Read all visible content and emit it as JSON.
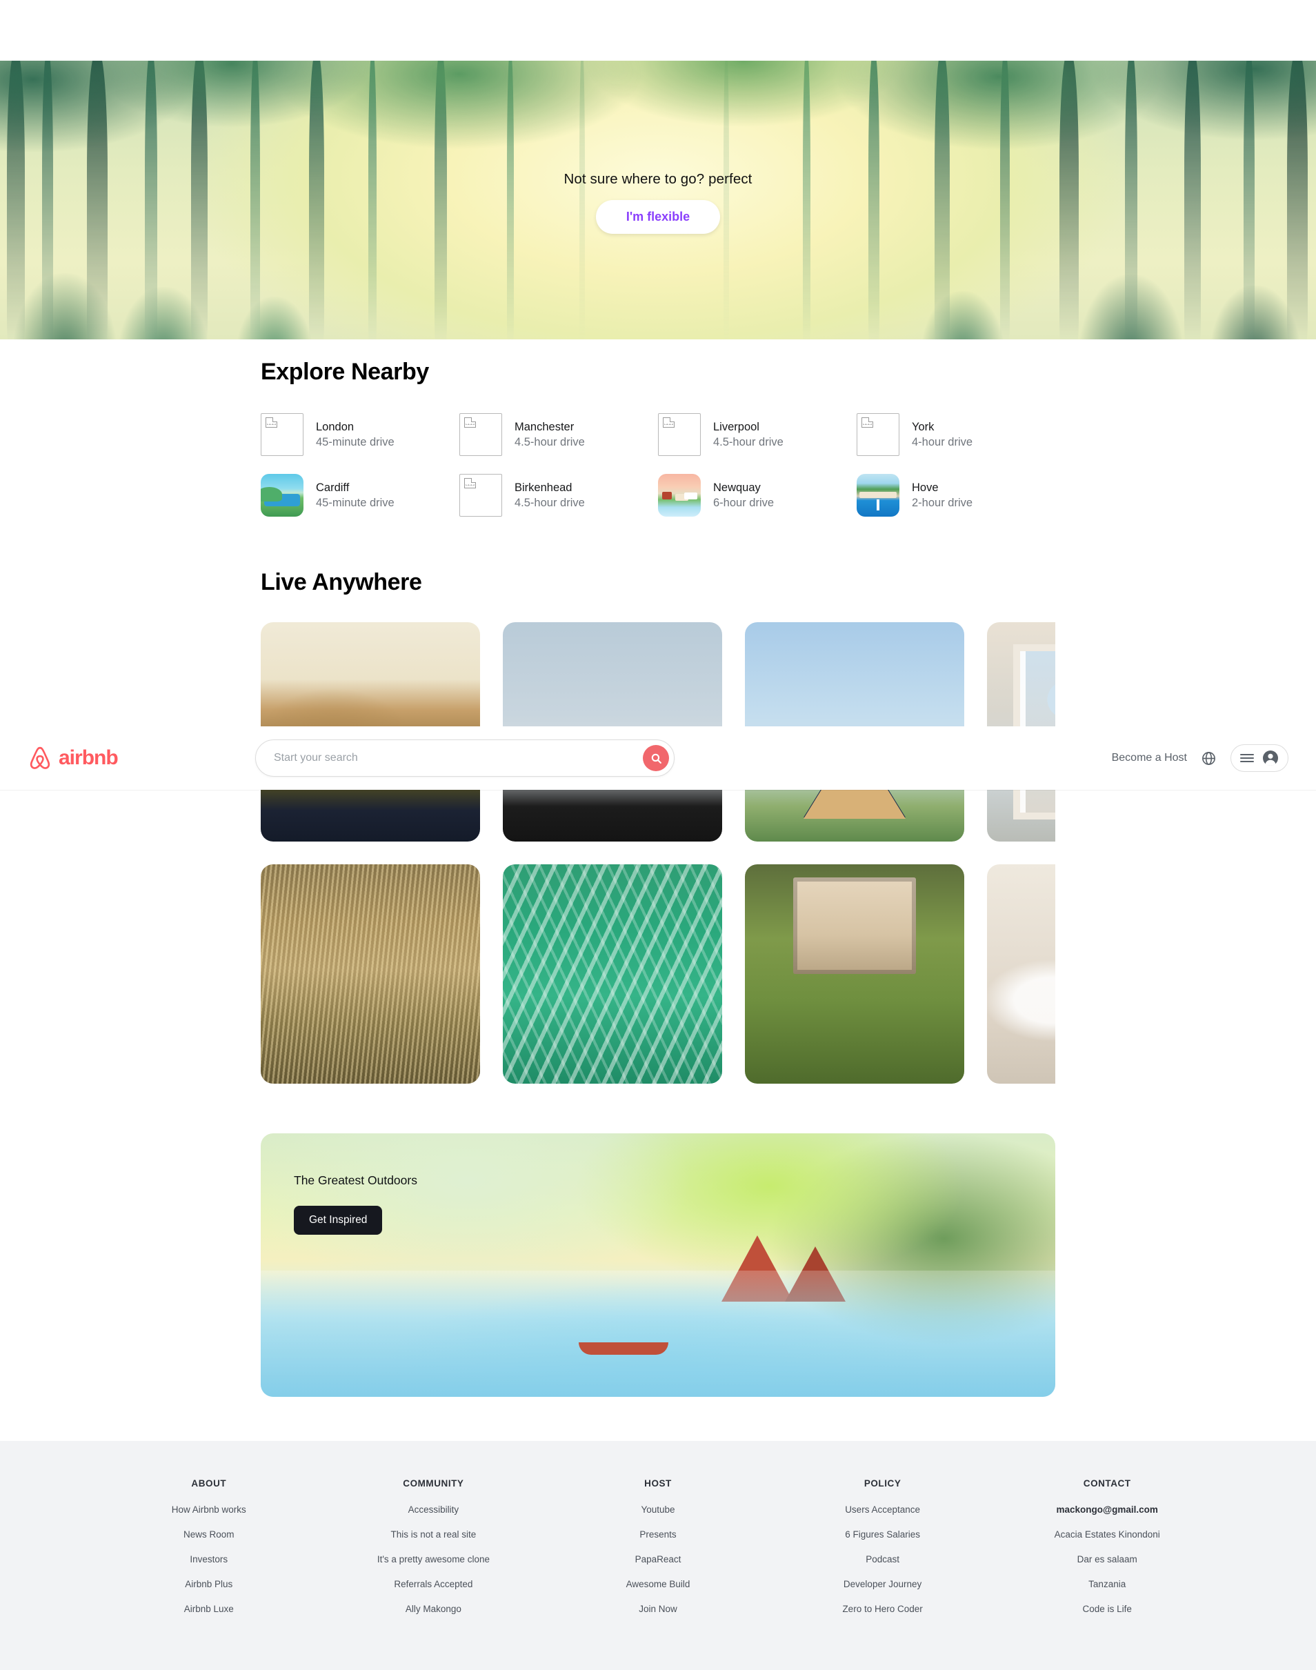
{
  "header": {
    "brand": {
      "name": "airbnb",
      "logo_icon": "airbnb-belo-icon",
      "color": "#FF5A5F"
    },
    "search": {
      "placeholder": "Start your search",
      "value": "",
      "icon": "search-icon"
    },
    "host_link": "Become a Host",
    "globe_icon": "globe-icon",
    "menu_icon": "hamburger-menu-icon",
    "avatar_icon": "user-avatar-icon"
  },
  "hero": {
    "title": "Not sure where to go? perfect",
    "button_label": "I'm flexible",
    "button_color": "#8a3ffc",
    "art": "forest-illustration"
  },
  "explore": {
    "title": "Explore Nearby",
    "cards": [
      {
        "name": "London",
        "distance": "45-minute drive",
        "image": "broken"
      },
      {
        "name": "Manchester",
        "distance": "4.5-hour drive",
        "image": "broken"
      },
      {
        "name": "Liverpool",
        "distance": "4.5-hour drive",
        "image": "broken"
      },
      {
        "name": "York",
        "distance": "4-hour drive",
        "image": "broken"
      },
      {
        "name": "Cardiff",
        "distance": "45-minute drive",
        "image": "art-cardiff"
      },
      {
        "name": "Birkenhead",
        "distance": "4.5-hour drive",
        "image": "broken"
      },
      {
        "name": "Newquay",
        "distance": "6-hour drive",
        "image": "art-newquay"
      },
      {
        "name": "Hove",
        "distance": "2-hour drive",
        "image": "art-hove"
      }
    ]
  },
  "live_anywhere": {
    "title": "Live Anywhere",
    "row_one": [
      {
        "photo": "ph-hills",
        "alt": "mountain-house-photo"
      },
      {
        "photo": "ph-sky",
        "alt": "rooftop-umbrella-photo"
      },
      {
        "photo": "ph-aframe",
        "alt": "a-frame-cabin-photo"
      },
      {
        "photo": "ph-window",
        "alt": "window-view-photo"
      }
    ],
    "row_two": [
      {
        "photo": "ph-grass",
        "alt": "tall-grass-fence-photo"
      },
      {
        "photo": "ph-water",
        "alt": "green-water-photo"
      },
      {
        "photo": "ph-lawn",
        "alt": "lawn-entrance-photo"
      },
      {
        "photo": "ph-bed",
        "alt": "bedding-photo"
      }
    ]
  },
  "banner": {
    "title": "The Greatest Outdoors",
    "button_label": "Get Inspired",
    "button_color": "#16181f",
    "art": "lake-campsite-illustration"
  },
  "footer": {
    "columns": [
      {
        "heading": "ABOUT",
        "links": [
          "How Airbnb works",
          "News Room",
          "Investors",
          "Airbnb Plus",
          "Airbnb Luxe"
        ]
      },
      {
        "heading": "COMMUNITY",
        "links": [
          "Accessibility",
          "This is not a real site",
          "It's a pretty awesome clone",
          "Referrals Accepted",
          "Ally Makongo"
        ]
      },
      {
        "heading": "HOST",
        "links": [
          "Youtube",
          "Presents",
          "PapaReact",
          "Awesome Build",
          "Join Now"
        ]
      },
      {
        "heading": "POLICY",
        "links": [
          "Users Acceptance",
          "6 Figures Salaries",
          "Podcast",
          "Developer Journey",
          "Zero to Hero Coder"
        ]
      },
      {
        "heading": "CONTACT",
        "links": [
          "mackongo@gmail.com",
          "Acacia Estates Kinondoni",
          "Dar es salaam",
          "Tanzania",
          "Code is Life"
        ],
        "bold_first": true
      }
    ]
  }
}
